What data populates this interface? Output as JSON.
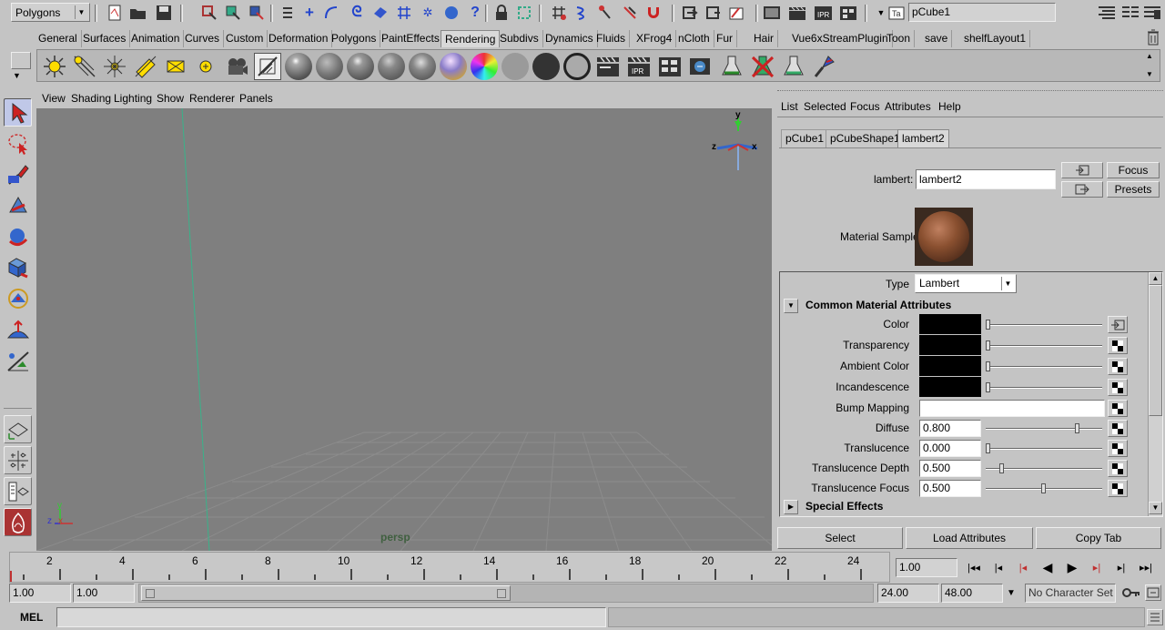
{
  "status_line": {
    "mode_menu": "Polygons",
    "object_name": "pCube1"
  },
  "shelf_tabs": [
    "General",
    "Surfaces",
    "Animation",
    "Curves",
    "Custom",
    "Deformation",
    "Polygons",
    "PaintEffects",
    "Rendering",
    "Subdivs",
    "Dynamics",
    "Fluids",
    "XFrog4",
    "nCloth",
    "Fur",
    "Hair",
    "Vue6xStreamPlugin",
    "Toon",
    "save",
    "shelfLayout1"
  ],
  "active_shelf_tab": "Rendering",
  "panel_menu": [
    "View",
    "Shading",
    "Lighting",
    "Show",
    "Renderer",
    "Panels"
  ],
  "viewport": {
    "camera_label": "persp",
    "axis_y": "y",
    "axis_z": "z",
    "axis_x": "x",
    "gnomon_x": "x",
    "gnomon_y": "y",
    "gnomon_z": "z"
  },
  "attribute_editor": {
    "menu": [
      "List",
      "Selected",
      "Focus",
      "Attributes",
      "Help"
    ],
    "tabs": [
      "pCube1",
      "pCubeShape1",
      "lambert2"
    ],
    "active_tab": "lambert2",
    "node_type_label": "lambert:",
    "node_name": "lambert2",
    "focus_button": "Focus",
    "presets_button": "Presets",
    "material_sample_label": "Material Sample",
    "type_label": "Type",
    "type_value": "Lambert",
    "section_common": "Common Material Attributes",
    "section_special": "Special Effects",
    "attrs": [
      {
        "label": "Color",
        "kind": "swatch",
        "slider": 0.0
      },
      {
        "label": "Transparency",
        "kind": "swatch",
        "slider": 0.0
      },
      {
        "label": "Ambient Color",
        "kind": "swatch",
        "slider": 0.0
      },
      {
        "label": "Incandescence",
        "kind": "swatch",
        "slider": 0.0
      },
      {
        "label": "Bump Mapping",
        "kind": "field",
        "value": ""
      },
      {
        "label": "Diffuse",
        "kind": "number",
        "value": "0.800",
        "slider": 0.8
      },
      {
        "label": "Translucence",
        "kind": "number",
        "value": "0.000",
        "slider": 0.0
      },
      {
        "label": "Translucence Depth",
        "kind": "number",
        "value": "0.500",
        "slider": 0.125
      },
      {
        "label": "Translucence Focus",
        "kind": "number",
        "value": "0.500",
        "slider": 0.5
      }
    ],
    "bottom_buttons": [
      "Select",
      "Load Attributes",
      "Copy Tab"
    ]
  },
  "time_slider": {
    "ticks": [
      "2",
      "4",
      "6",
      "8",
      "10",
      "12",
      "14",
      "16",
      "18",
      "20",
      "22",
      "24"
    ],
    "current_frame": "1.00"
  },
  "range_slider": {
    "start_time": "1.00",
    "playback_start": "1.00",
    "playback_end": "24.00",
    "end_time": "48.00",
    "character_set": "No Character Set"
  },
  "command_line": {
    "label": "MEL"
  },
  "colors": {
    "ui_bg": "#c4c4c4",
    "viewport_bg": "#7f7f7f",
    "grid": "#8a8a8a",
    "axis_green": "#39b38a",
    "current_time": "#c03030"
  }
}
